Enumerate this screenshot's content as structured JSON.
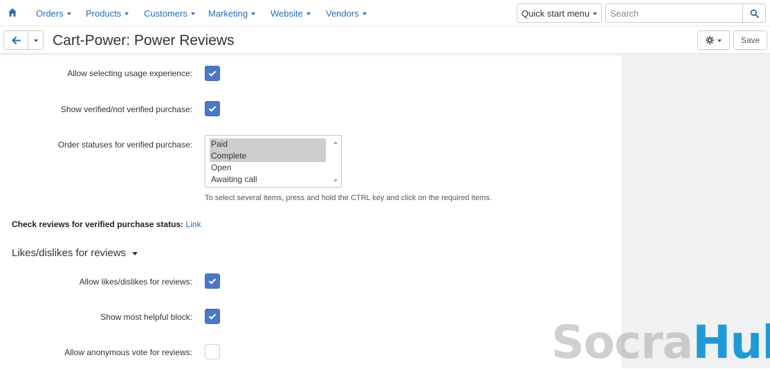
{
  "topnav": {
    "home_icon": "home-icon",
    "menus": [
      "Orders",
      "Products",
      "Customers",
      "Marketing",
      "Website",
      "Vendors"
    ],
    "quick_start": "Quick start menu",
    "search_placeholder": "Search",
    "search_icon": "search-icon"
  },
  "titlebar": {
    "title": "Cart-Power: Power Reviews",
    "back_icon": "arrow-left-icon",
    "settings_icon": "gear-icon",
    "save_label": "Save"
  },
  "form": {
    "usage_label": "Allow selecting usage experience:",
    "usage_checked": true,
    "verified_label": "Show verified/not verified purchase:",
    "verified_checked": true,
    "statuses_label": "Order statuses for verified purchase:",
    "statuses": [
      {
        "label": "Paid",
        "selected": true
      },
      {
        "label": "Complete",
        "selected": true
      },
      {
        "label": "Open",
        "selected": false
      },
      {
        "label": "Awaiting call",
        "selected": false
      }
    ],
    "help_text": "To select several items, press and hold the CTRL key and click on the required items.",
    "check_label": "Check reviews for verified purchase status:",
    "check_link": "Link"
  },
  "likes_section": {
    "title": "Likes/dislikes for reviews",
    "allow_label": "Allow likes/dislikes for reviews:",
    "allow_checked": true,
    "helpful_label": "Show most helpful block:",
    "helpful_checked": true,
    "anonymous_label": "Allow anonymous vote for reviews:",
    "anonymous_checked": false
  },
  "watermark": {
    "part1": "Socra",
    "part2": "Hub"
  },
  "colors": {
    "accent": "#4a78c8",
    "link": "#2a6cb0",
    "sidebar": "#f0f1f2"
  }
}
